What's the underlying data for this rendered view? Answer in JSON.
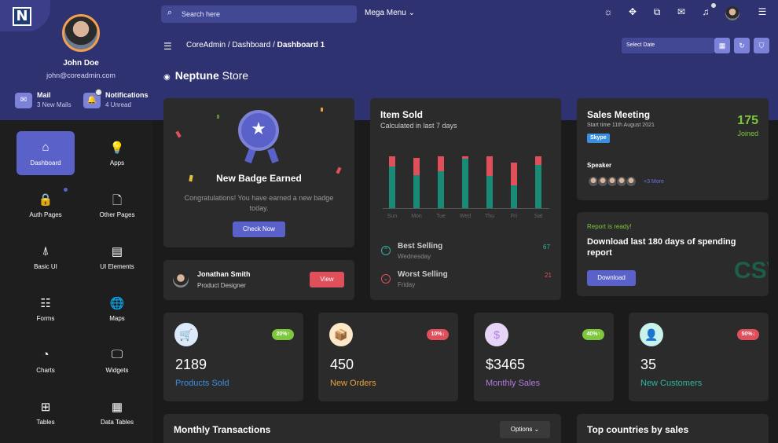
{
  "sidebar": {
    "logo_letter": "N",
    "user_name": "John Doe",
    "user_email": "john@coreadmin.com",
    "mail": {
      "title": "Mail",
      "sub": "3 New Mails"
    },
    "notifications": {
      "title": "Notifications",
      "sub": "4 Unread"
    },
    "items": [
      {
        "label": "Dashboard",
        "icon": "⌂",
        "icon_name": "home-icon"
      },
      {
        "label": "Apps",
        "icon": "💡",
        "icon_name": "lightbulb-icon"
      },
      {
        "label": "Auth Pages",
        "icon": "🔒",
        "icon_name": "lock-icon"
      },
      {
        "label": "Other Pages",
        "icon": "🗋",
        "icon_name": "file-icon"
      },
      {
        "label": "Basic UI",
        "icon": "⍋",
        "icon_name": "compass-icon"
      },
      {
        "label": "UI Elements",
        "icon": "▤",
        "icon_name": "list-icon"
      },
      {
        "label": "Forms",
        "icon": "☷",
        "icon_name": "form-icon"
      },
      {
        "label": "Maps",
        "icon": "🌐",
        "icon_name": "globe-icon"
      },
      {
        "label": "Charts",
        "icon": "◔",
        "icon_name": "pie-chart-icon"
      },
      {
        "label": "Widgets",
        "icon": "🖵",
        "icon_name": "monitor-icon"
      },
      {
        "label": "Tables",
        "icon": "⊞",
        "icon_name": "table-icon"
      },
      {
        "label": "Data Tables",
        "icon": "▦",
        "icon_name": "grid-icon"
      }
    ]
  },
  "topbar": {
    "search_placeholder": "Search here",
    "mega_menu": "Mega Menu ⌄"
  },
  "breadcrumb": {
    "root": "CoreAdmin",
    "mid": "Dashboard",
    "current": "Dashboard 1"
  },
  "date_filter": {
    "placeholder": "Select Date"
  },
  "page_title": {
    "bold": "Neptune",
    "rest": " Store"
  },
  "badge_card": {
    "title": "New Badge Earned",
    "text": "Congratulations! You have earned a new badge today.",
    "button": "Check Now"
  },
  "profile_card": {
    "name": "Jonathan Smith",
    "role": "Product Designer",
    "button": "View"
  },
  "item_sold": {
    "title": "Item Sold",
    "subtitle": "Calculated in last 7 days",
    "best_label": "Best Selling",
    "best_day": "Wednesday",
    "best_value": "67",
    "worst_label": "Worst Selling",
    "worst_day": "Friday",
    "worst_value": "21"
  },
  "chart_data": {
    "type": "bar",
    "categories": [
      "Sun",
      "Mon",
      "Tue",
      "Wed",
      "Thu",
      "Fri",
      "Sat"
    ],
    "series": [
      {
        "values": [
          72,
          58,
          65,
          86,
          56,
          40,
          76
        ]
      },
      {
        "values": [
          18,
          30,
          25,
          4,
          34,
          40,
          14
        ]
      }
    ],
    "stacked": true,
    "colors": [
      "#188a76",
      "#e0505a"
    ]
  },
  "meeting": {
    "title": "Sales Meeting",
    "time": "Start time 11th August 2021",
    "tag": "Skype",
    "count": "175",
    "count_label": "Joined",
    "speaker_label": "Speaker",
    "more": "+3 More"
  },
  "report": {
    "status": "Report is ready!",
    "title": "Download last 180 days of spending report",
    "button": "Download",
    "watermark": "CSV"
  },
  "stats": [
    {
      "value": "2189",
      "label": "Products Sold",
      "pct": "20%↑",
      "color": "#3a8fe0",
      "pct_bg": "#7dc73a",
      "icon": "🛒",
      "icon_bg": "#dbe9fb"
    },
    {
      "value": "450",
      "label": "New Orders",
      "pct": "10%↓",
      "color": "#e9a23b",
      "pct_bg": "#e0505a",
      "icon": "📦",
      "icon_bg": "#fde7c6"
    },
    {
      "value": "$3465",
      "label": "Monthly Sales",
      "pct": "40%↑",
      "color": "#b17ae0",
      "pct_bg": "#7dc73a",
      "icon": "$",
      "icon_bg": "#e7d5f8"
    },
    {
      "value": "35",
      "label": "New Customers",
      "pct": "50%↓",
      "color": "#2fb5a0",
      "pct_bg": "#e0505a",
      "icon": "👤",
      "icon_bg": "#c8f3ec"
    }
  ],
  "transactions": {
    "title": "Monthly Transactions",
    "options": "Options ⌄"
  },
  "countries": {
    "title": "Top countries by sales"
  }
}
